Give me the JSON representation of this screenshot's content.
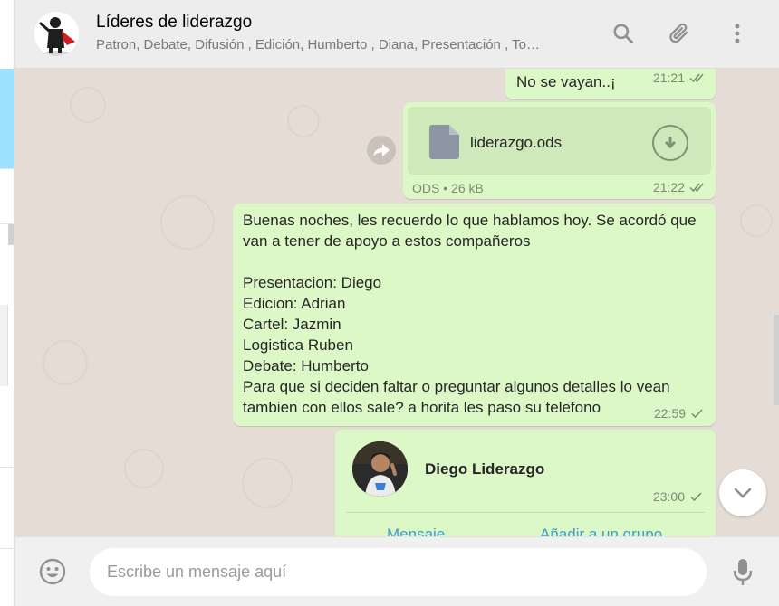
{
  "header": {
    "title": "Líderes de liderazgo",
    "subtitle": "Patron, Debate, Difusión , Edición, Humberto , Diana, Presentación , To…"
  },
  "messages": [
    {
      "text": "No se vayan..¡",
      "time": "21:21",
      "status": "read"
    },
    {
      "file_name": "liderazgo.ods",
      "file_type": "ODS",
      "file_size": "26 kB",
      "time": "21:22",
      "status": "read"
    },
    {
      "text": "Buenas noches, les recuerdo lo que hablamos hoy. Se acordó que van a tener de apoyo a estos compañeros\n\nPresentacion: Diego\nEdicion: Adrian\nCartel: Jazmin\nLogistica Ruben\nDebate: Humberto\nPara que si deciden faltar o preguntar algunos detalles lo vean tambien con ellos sale? a horita les paso su telefono",
      "time": "22:59",
      "status": "sent"
    },
    {
      "contact_name": "Diego Liderazgo",
      "time": "23:00",
      "status": "sent",
      "action_message": "Mensaje",
      "action_add_group": "Añadir a un grupo"
    }
  ],
  "composer": {
    "placeholder": "Escribe un mensaje aquí"
  },
  "colors": {
    "outgoing_bubble": "#dcf8c6",
    "chat_background": "#e5ddd5",
    "header_background": "#ededed",
    "read_tick": "#7a8b73",
    "link": "#3e9bd4"
  },
  "icons": {
    "search": "search-icon",
    "attach": "paperclip-icon",
    "menu": "kebab-menu-icon",
    "download": "download-icon",
    "forward": "forward-icon",
    "scroll_down": "chevron-down-icon",
    "emoji": "emoji-icon",
    "mic": "microphone-icon"
  }
}
